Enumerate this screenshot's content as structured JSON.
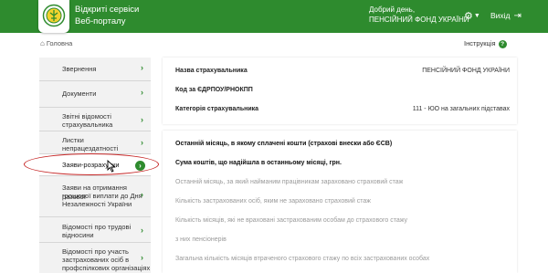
{
  "header": {
    "brand_line1": "Відкриті сервіси",
    "brand_line2": "Веб-порталу",
    "greeting_line1": "Добрий день,",
    "greeting_line2": "ПЕНСІЙНИЙ ФОНД УКРАЇНИ",
    "settings_icon": "gear-icon",
    "logout_label": "Вихід",
    "logout_icon": "sign-out-icon",
    "brand_color": "#2e8b2e"
  },
  "breadcrumb": {
    "home_label": "Головна"
  },
  "instructions": {
    "label": "Інструкція"
  },
  "sidebar": {
    "items": [
      {
        "label1": "Звернення",
        "label2": "",
        "label3": ""
      },
      {
        "label1": "Документи",
        "label2": "",
        "label3": ""
      },
      {
        "label1": "Звітні відомості",
        "label2": "страхувальника",
        "label3": ""
      },
      {
        "label1": "Листки",
        "label2": "непрацездатності",
        "label3": ""
      },
      {
        "label1": "Заяви-розрахунки",
        "label2": "",
        "label3": ""
      },
      {
        "label1": "Заяви на отримання разової",
        "label2": "грошової виплати до Дня",
        "label3": "Незалежності України"
      },
      {
        "label1": "Відомості про трудові",
        "label2": "відносини",
        "label3": ""
      },
      {
        "label1": "Відомості про участь",
        "label2": "застрахованих осіб в",
        "label3": "профспілкових організаціях"
      }
    ]
  },
  "insurer_panel": {
    "name_label": "Назва страхувальника",
    "name_value": "ПЕНСІЙНИЙ ФОНД УКРАЇНИ",
    "code_label": "Код за ЄДРПОУ/РНОКПП",
    "code_value": "",
    "category_label": "Категорія страхувальника",
    "category_value": "111 - ЮО на загальних підставах"
  },
  "payment_panel": {
    "rows": [
      "Останній місяць, в якому сплачені кошти (страхові внески або ЄСВ)",
      "Сума коштів, що надійшла в останньому місяці, грн.",
      "Останній місяць, за який найманим працівникам зараховано страховий стаж",
      "Кількість застрахованих осіб, яким не зараховано страховий стаж",
      "Кількість місяців, які не враховані застрахованим особам до страхового стажу",
      "з них пенсіонерів",
      "Загальна кількість місяців втраченого страхового стажу по всіх застрахованих особах"
    ]
  }
}
